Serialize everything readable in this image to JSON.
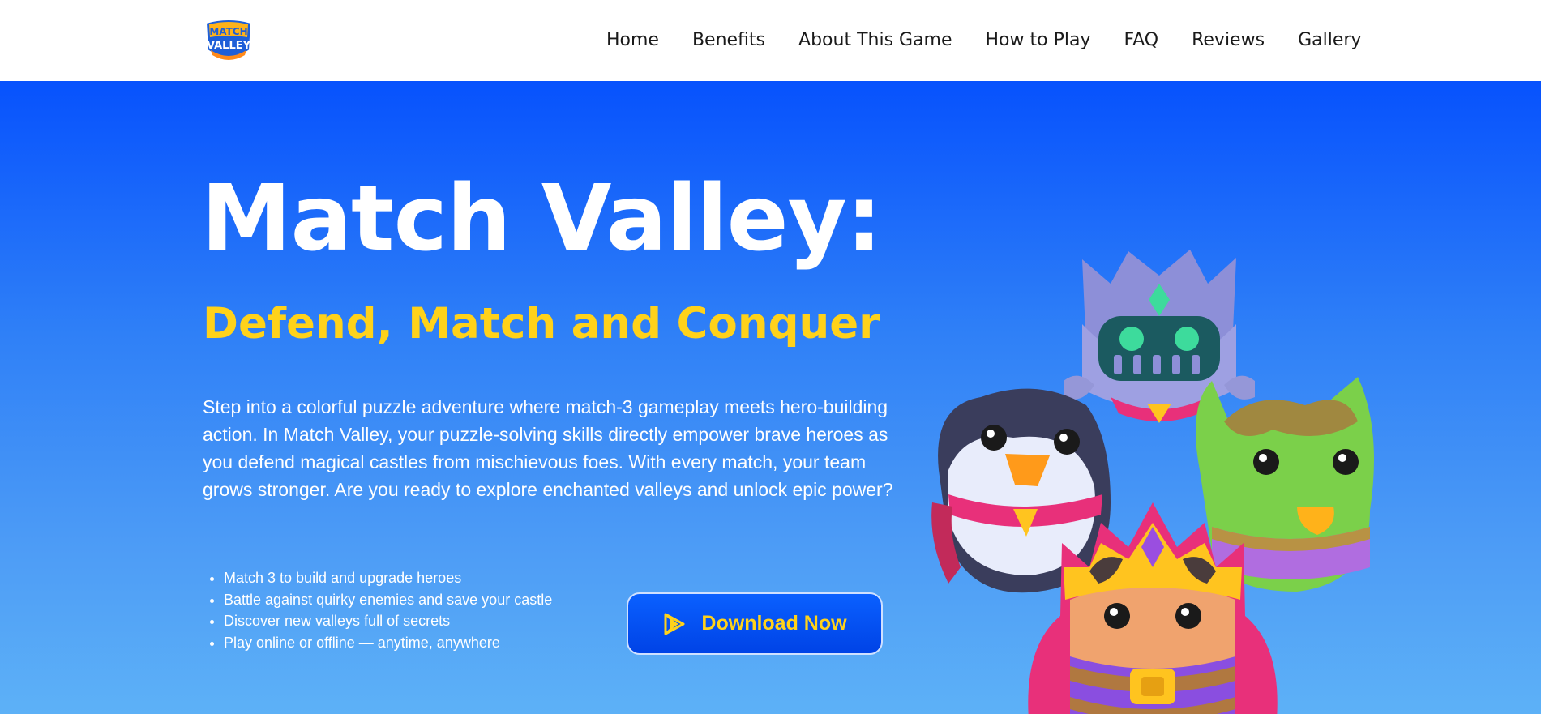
{
  "header": {
    "logo_text_top": "MATCH",
    "logo_text_bottom": "VALLEY",
    "nav": [
      "Home",
      "Benefits",
      "About This Game",
      "How to Play",
      "FAQ",
      "Reviews",
      "Gallery"
    ]
  },
  "hero": {
    "title": "Match Valley:",
    "subtitle": "Defend, Match and Conquer",
    "description": "Step into a colorful puzzle adventure where match-3 gameplay meets hero-building action. In Match Valley, your puzzle-solving skills directly empower brave heroes as you defend magical castles from mischievous foes. With every match, your team grows stronger. Are you ready to explore enchanted valleys and unlock epic power?",
    "features": [
      "Match 3 to build and upgrade heroes",
      "Battle against quirky enemies and save your castle",
      "Discover new valleys full of secrets",
      "Play online or offline — anytime, anywhere"
    ],
    "cta_label": "Download Now",
    "cta_icon": "play-store-icon"
  },
  "colors": {
    "hero_gradient_top": "#0752fd",
    "hero_gradient_bottom": "#5db1f7",
    "accent_yellow": "#ffd21a",
    "button_blue": "#0043e6"
  }
}
